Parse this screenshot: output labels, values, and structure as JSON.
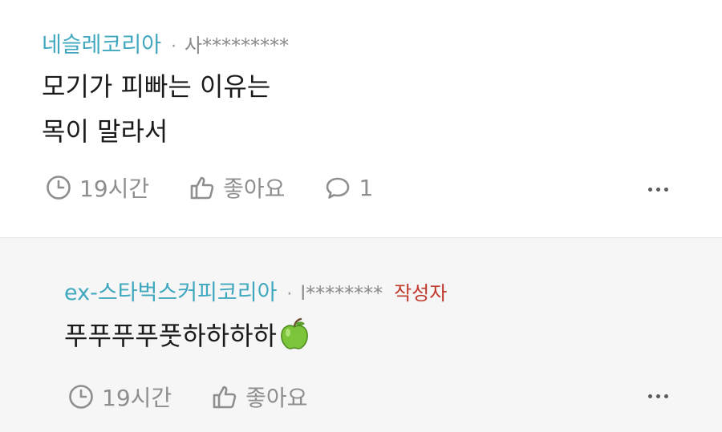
{
  "comments": [
    {
      "author": "네슬레코리아",
      "separator": "·",
      "masked_id": "사*********",
      "body_lines": [
        "모기가 피빠는 이유는",
        "목이 말라서"
      ],
      "time": "19시간",
      "like_label": "좋아요",
      "reply_count": "1"
    },
    {
      "author": "ex-스타벅스커피코리아",
      "separator": "·",
      "masked_id": "l********",
      "badge": "작성자",
      "body": "푸푸푸푸풋하하하하",
      "time": "19시간",
      "like_label": "좋아요"
    }
  ],
  "icons": {
    "time": "clock-icon",
    "like": "thumbs-up-icon",
    "reply": "speech-bubble-icon",
    "more": "more-dots-icon",
    "emoji": "green-apple-emoji"
  },
  "colors": {
    "author": "#3fa8bf",
    "badge": "#c0392b",
    "meta": "#8e8e8e",
    "reply_background": "#f6f6f6"
  }
}
